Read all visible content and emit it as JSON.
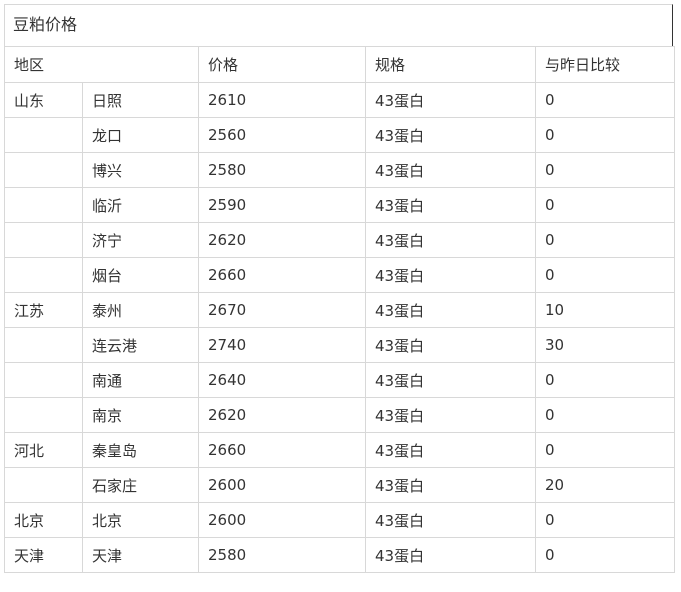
{
  "title": "豆粕价格",
  "headers": {
    "region": "地区",
    "price": "价格",
    "spec": "规格",
    "change": "与昨日比较"
  },
  "rows": [
    {
      "region": "山东",
      "city": "日照",
      "price": "2610",
      "spec": "43蛋白",
      "change": "0"
    },
    {
      "region": "",
      "city": "龙口",
      "price": "2560",
      "spec": "43蛋白",
      "change": "0"
    },
    {
      "region": "",
      "city": "博兴",
      "price": "2580",
      "spec": "43蛋白",
      "change": "0"
    },
    {
      "region": "",
      "city": "临沂",
      "price": "2590",
      "spec": "43蛋白",
      "change": "0"
    },
    {
      "region": "",
      "city": "济宁",
      "price": "2620",
      "spec": "43蛋白",
      "change": "0"
    },
    {
      "region": "",
      "city": "烟台",
      "price": "2660",
      "spec": "43蛋白",
      "change": "0"
    },
    {
      "region": "江苏",
      "city": "泰州",
      "price": "2670",
      "spec": "43蛋白",
      "change": "10"
    },
    {
      "region": "",
      "city": "连云港",
      "price": "2740",
      "spec": "43蛋白",
      "change": "30"
    },
    {
      "region": "",
      "city": "南通",
      "price": "2640",
      "spec": "43蛋白",
      "change": "0"
    },
    {
      "region": "",
      "city": "南京",
      "price": "2620",
      "spec": "43蛋白",
      "change": "0"
    },
    {
      "region": "河北",
      "city": "秦皇岛",
      "price": "2660",
      "spec": "43蛋白",
      "change": "0"
    },
    {
      "region": "",
      "city": "石家庄",
      "price": "2600",
      "spec": "43蛋白",
      "change": "20"
    },
    {
      "region": "北京",
      "city": "北京",
      "price": "2600",
      "spec": "43蛋白",
      "change": "0"
    },
    {
      "region": "天津",
      "city": "天津",
      "price": "2580",
      "spec": "43蛋白",
      "change": "0"
    }
  ]
}
